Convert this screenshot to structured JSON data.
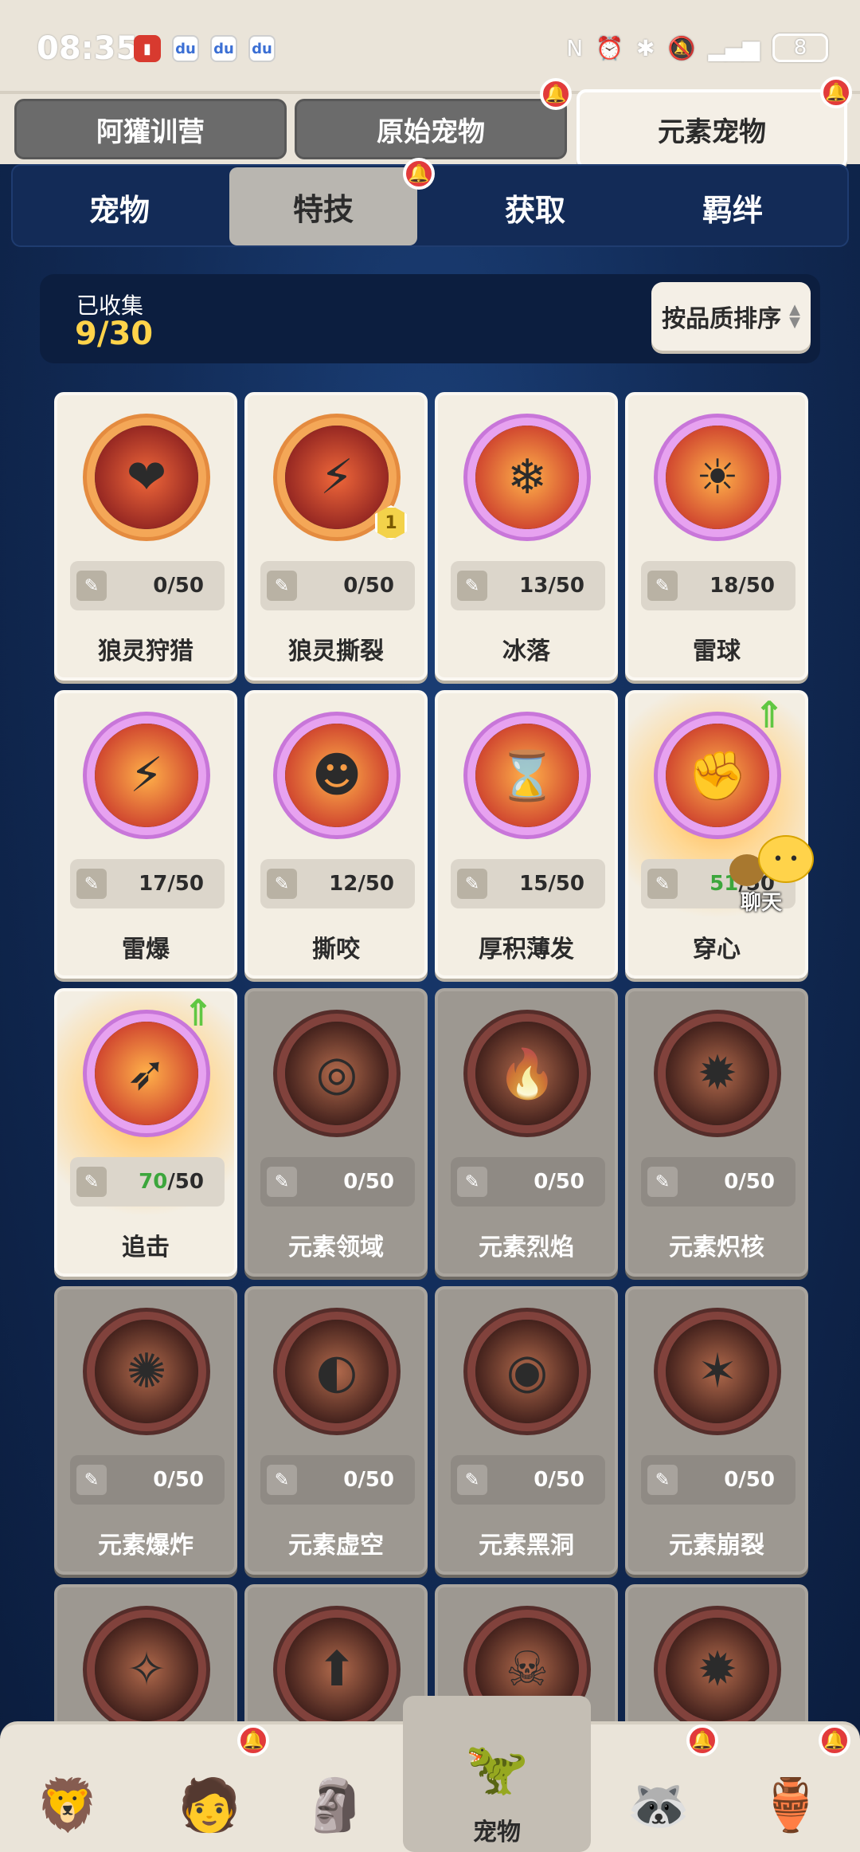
{
  "status_bar": {
    "time": "08:35",
    "battery": "8"
  },
  "top_tabs": [
    {
      "label": "阿獾训营",
      "active": false
    },
    {
      "label": "原始宠物",
      "active": false
    },
    {
      "label": "元素宠物",
      "active": true
    }
  ],
  "sub_tabs": [
    {
      "label": "宠物",
      "active": false
    },
    {
      "label": "特技",
      "active": true
    },
    {
      "label": "获取",
      "active": false
    },
    {
      "label": "羁绊",
      "active": false
    }
  ],
  "collection": {
    "label": "已收集",
    "value": "9/30",
    "sort_label": "按品质排序"
  },
  "skills": [
    {
      "name": "狼灵狩猎",
      "owned": "0",
      "total": "/50",
      "ring": "orange",
      "icon": "❤"
    },
    {
      "name": "狼灵撕裂",
      "owned": "0",
      "total": "/50",
      "ring": "orange",
      "icon": "⚡",
      "level": "1"
    },
    {
      "name": "冰落",
      "owned": "13",
      "total": "/50",
      "ring": "purple",
      "icon": "❄"
    },
    {
      "name": "雷球",
      "owned": "18",
      "total": "/50",
      "ring": "purple",
      "icon": "☀"
    },
    {
      "name": "雷爆",
      "owned": "17",
      "total": "/50",
      "ring": "purple",
      "icon": "⚡"
    },
    {
      "name": "撕咬",
      "owned": "12",
      "total": "/50",
      "ring": "purple",
      "icon": "☻"
    },
    {
      "name": "厚积薄发",
      "owned": "15",
      "total": "/50",
      "ring": "purple",
      "icon": "⌛"
    },
    {
      "name": "穿心",
      "owned": "51",
      "total": "/50",
      "ring": "purple",
      "icon": "✊",
      "upgrade": true
    },
    {
      "name": "追击",
      "owned": "70",
      "total": "/50",
      "ring": "purple",
      "icon": "➶",
      "upgrade": true
    },
    {
      "name": "元素领域",
      "owned": "0",
      "total": "/50",
      "ring": "dark",
      "icon": "◎",
      "locked": true
    },
    {
      "name": "元素烈焰",
      "owned": "0",
      "total": "/50",
      "ring": "dark",
      "icon": "🔥",
      "locked": true
    },
    {
      "name": "元素炽核",
      "owned": "0",
      "total": "/50",
      "ring": "dark",
      "icon": "✹",
      "locked": true
    },
    {
      "name": "元素爆炸",
      "owned": "0",
      "total": "/50",
      "ring": "dark",
      "icon": "✺",
      "locked": true
    },
    {
      "name": "元素虚空",
      "owned": "0",
      "total": "/50",
      "ring": "dark",
      "icon": "◐",
      "locked": true
    },
    {
      "name": "元素黑洞",
      "owned": "0",
      "total": "/50",
      "ring": "dark",
      "icon": "◉",
      "locked": true
    },
    {
      "name": "元素崩裂",
      "owned": "0",
      "total": "/50",
      "ring": "dark",
      "icon": "✶",
      "locked": true
    },
    {
      "name": "",
      "owned": "",
      "total": "",
      "ring": "dark",
      "icon": "✧",
      "locked": true
    },
    {
      "name": "",
      "owned": "",
      "total": "",
      "ring": "dark",
      "icon": "⬆",
      "locked": true
    },
    {
      "name": "",
      "owned": "",
      "total": "",
      "ring": "dark",
      "icon": "☠",
      "locked": true
    },
    {
      "name": "",
      "owned": "",
      "total": "",
      "ring": "dark",
      "icon": "✹",
      "locked": true
    }
  ],
  "chat": {
    "label": "聊天"
  },
  "bottom_nav": [
    {
      "label": "",
      "icon": "🦁",
      "badge": false
    },
    {
      "label": "",
      "icon": "🧑",
      "badge": true
    },
    {
      "label": "",
      "icon": "🗿",
      "badge": false
    },
    {
      "label": "宠物",
      "icon": "🦖",
      "badge": false,
      "active": true
    },
    {
      "label": "",
      "icon": "🦝",
      "badge": true
    },
    {
      "label": "",
      "icon": "🏺",
      "badge": true
    }
  ],
  "colors": {
    "accent_gold": "#ffd34a",
    "badge_red": "#e23b3b",
    "progress_green": "#3ca63c"
  }
}
